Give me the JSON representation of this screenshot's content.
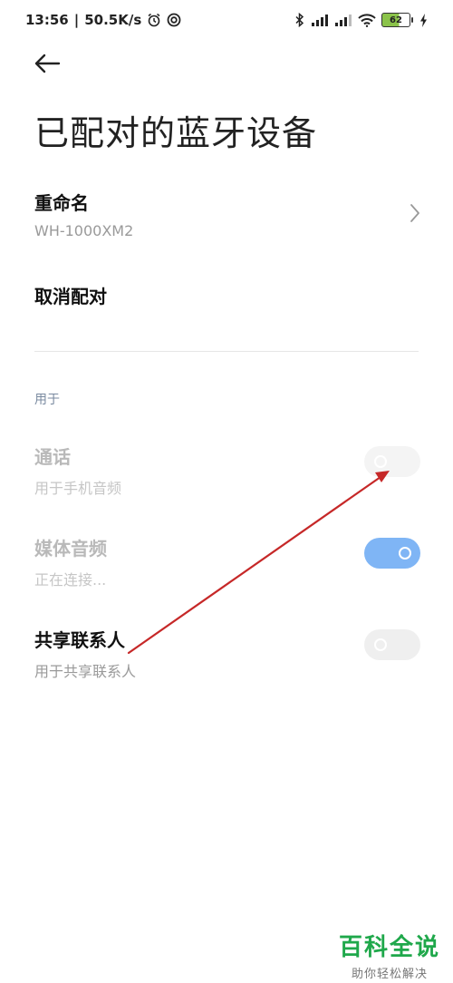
{
  "status_bar": {
    "time": "13:56",
    "separator": "|",
    "speed": "50.5K/s",
    "battery": "62",
    "icons": [
      "alarm-icon",
      "vpn-icon",
      "bluetooth-icon",
      "signal-icon",
      "signal-icon",
      "wifi-icon",
      "battery-icon",
      "charging-icon"
    ]
  },
  "header": {
    "back_icon": "back-arrow-icon",
    "title": "已配对的蓝牙设备"
  },
  "rename": {
    "title": "重命名",
    "device_name": "WH-1000XM2",
    "icon": "chevron-right-icon"
  },
  "unpair": {
    "title": "取消配对"
  },
  "usage": {
    "section_label": "用于",
    "items": [
      {
        "title": "通话",
        "subtitle": "用于手机音频",
        "enabled": false,
        "on": false
      },
      {
        "title": "媒体音频",
        "subtitle": "正在连接...",
        "enabled": false,
        "on": true
      },
      {
        "title": "共享联系人",
        "subtitle": "用于共享联系人",
        "enabled": true,
        "on": false
      }
    ]
  },
  "annotation": {
    "color": "#c62828"
  },
  "watermark": {
    "title": "百科全说",
    "subtitle": "助你轻松解决",
    "color": "#1fa84b"
  }
}
